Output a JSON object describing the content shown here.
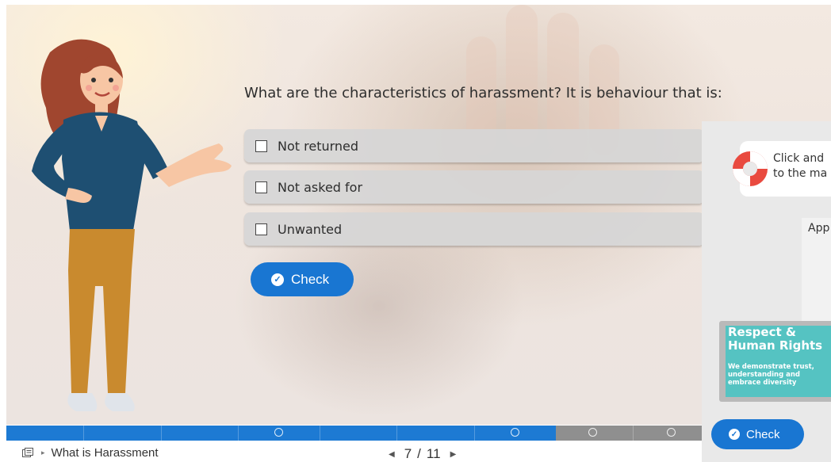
{
  "quiz": {
    "question": "What are the characteristics of harassment? It is behaviour that is:",
    "options": [
      {
        "label": "Not returned",
        "checked": false
      },
      {
        "label": "Not asked for",
        "checked": false
      },
      {
        "label": "Unwanted",
        "checked": false
      }
    ],
    "check_label": "Check"
  },
  "side_panel": {
    "callout_line1": "Click and",
    "callout_line2": "to the ma",
    "app_label": "App",
    "card_title_line1": "Respect &",
    "card_title_line2": "Human Rights",
    "card_sub_line1": "We demonstrate trust,",
    "card_sub_line2": "understanding and",
    "card_sub_line3": "embrace diversity",
    "check_label": "Check"
  },
  "nav": {
    "breadcrumb": "What is Harassment",
    "page_current": "7",
    "page_separator": "/",
    "page_total": "11",
    "progress_fraction": 0.79
  },
  "colors": {
    "accent": "#1976d2",
    "option_bg": "#d6d6d6",
    "card_teal": "#55c3c2"
  }
}
